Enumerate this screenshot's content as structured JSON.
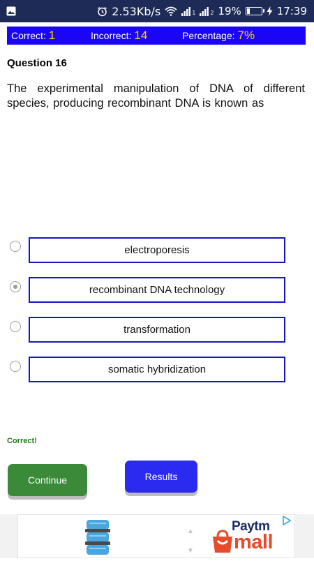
{
  "status_bar": {
    "net_speed": "2.53Kb/s",
    "sim1": "1",
    "sim2": "2",
    "battery": "19%",
    "battery_level": 0.19,
    "time": "17:39"
  },
  "score": {
    "correct_label": "Correct:",
    "correct_value": "1",
    "incorrect_label": "Incorrect:",
    "incorrect_value": "14",
    "percentage_label": "Percentage:",
    "percentage_value": "7%"
  },
  "question": {
    "number": "Question 16",
    "text": "The experimental manipulation of DNA of different species, producing recombinant DNA is known as"
  },
  "options": [
    {
      "label": "electroporesis",
      "selected": false
    },
    {
      "label": "recombinant DNA technology",
      "selected": true
    },
    {
      "label": "transformation",
      "selected": false
    },
    {
      "label": "somatic hybridization",
      "selected": false
    }
  ],
  "feedback": "Correct!",
  "buttons": {
    "continue": "Continue",
    "results": "Results"
  },
  "ad": {
    "brand_top": "Paytm",
    "brand_bottom": "mall",
    "icon": "server-stack-icon"
  },
  "colors": {
    "status_bar": "#1e2b57",
    "score_bar": "#1a06f5",
    "score_value": "#ffd400",
    "option_border": "#1616c8",
    "continue": "#3a8a3a",
    "results": "#2a2af0",
    "feedback": "#1a7a1a"
  }
}
